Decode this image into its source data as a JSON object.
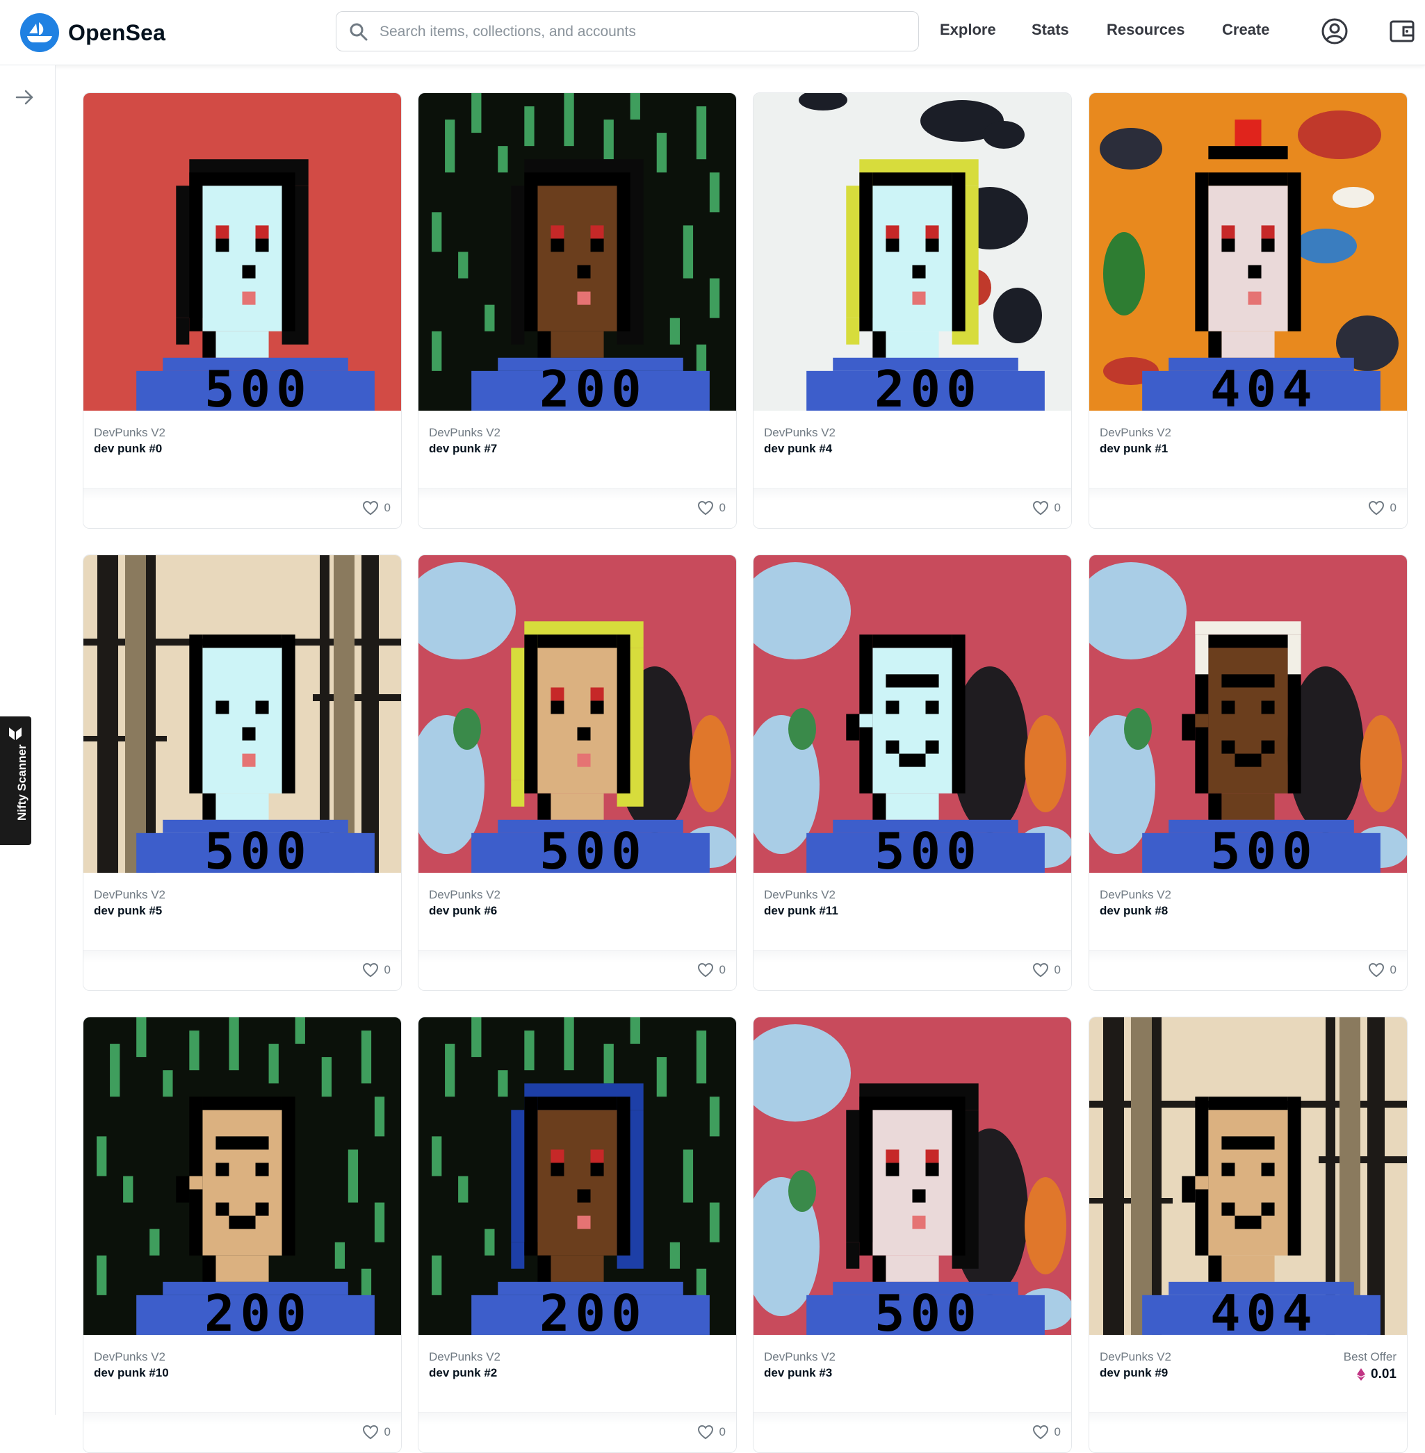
{
  "app": {
    "name": "OpenSea"
  },
  "search": {
    "placeholder": "Search items, collections, and accounts",
    "value": ""
  },
  "nav": [
    {
      "label": "Explore"
    },
    {
      "label": "Stats"
    },
    {
      "label": "Resources"
    },
    {
      "label": "Create"
    }
  ],
  "header_icons": [
    "account-circle-icon",
    "wallet-icon"
  ],
  "sidebar": {
    "toggle_icon": "arrow-right-icon",
    "extension_label": "Nifty Scanner"
  },
  "cards": [
    {
      "collection": "DevPunks V2",
      "name": "dev punk #0",
      "likes": "0",
      "code": "500",
      "bg": "red",
      "skin": "#cdf4f7",
      "hair": "black",
      "face": "female"
    },
    {
      "collection": "DevPunks V2",
      "name": "dev punk #7",
      "likes": "0",
      "code": "200",
      "bg": "matrix",
      "skin": "#6b3e1d",
      "hair": "black",
      "face": "female"
    },
    {
      "collection": "DevPunks V2",
      "name": "dev punk #4",
      "likes": "0",
      "code": "200",
      "bg": "ink",
      "skin": "#cdf4f7",
      "hair": "blonde",
      "face": "female"
    },
    {
      "collection": "DevPunks V2",
      "name": "dev punk #1",
      "likes": "0",
      "code": "404",
      "bg": "orange",
      "skin": "#ead9d9",
      "hair": "tiara",
      "face": "female"
    },
    {
      "collection": "DevPunks V2",
      "name": "dev punk #5",
      "likes": "0",
      "code": "500",
      "bg": "marble",
      "skin": "#cdf4f7",
      "hair": "bald",
      "face": "female"
    },
    {
      "collection": "DevPunks V2",
      "name": "dev punk #6",
      "likes": "0",
      "code": "500",
      "bg": "map",
      "skin": "#dbb180",
      "hair": "blonde",
      "face": "female"
    },
    {
      "collection": "DevPunks V2",
      "name": "dev punk #11",
      "likes": "0",
      "code": "500",
      "bg": "map",
      "skin": "#cdf4f7",
      "hair": "none",
      "face": "male"
    },
    {
      "collection": "DevPunks V2",
      "name": "dev punk #8",
      "likes": "0",
      "code": "500",
      "bg": "map",
      "skin": "#6b3e1d",
      "hair": "band",
      "face": "male"
    },
    {
      "collection": "DevPunks V2",
      "name": "dev punk #10",
      "likes": "0",
      "code": "200",
      "bg": "matrix",
      "skin": "#dbb180",
      "hair": "none",
      "face": "male"
    },
    {
      "collection": "DevPunks V2",
      "name": "dev punk #2",
      "likes": "0",
      "code": "200",
      "bg": "matrix",
      "skin": "#6b3e1d",
      "hair": "blue",
      "face": "female"
    },
    {
      "collection": "DevPunks V2",
      "name": "dev punk #3",
      "likes": "0",
      "code": "500",
      "bg": "map",
      "skin": "#ead9d9",
      "hair": "black",
      "face": "female"
    },
    {
      "collection": "DevPunks V2",
      "name": "dev punk #9",
      "likes": "",
      "code": "404",
      "bg": "marble",
      "skin": "#dbb180",
      "hair": "none",
      "face": "male",
      "best_offer_label": "Best Offer",
      "best_offer_price": "0.01"
    }
  ],
  "colors": {
    "brand": "#2081e2",
    "shirt": "#3d5ecb",
    "text_primary": "#04111d",
    "text_secondary": "#707a83",
    "eth": "#c13584"
  }
}
